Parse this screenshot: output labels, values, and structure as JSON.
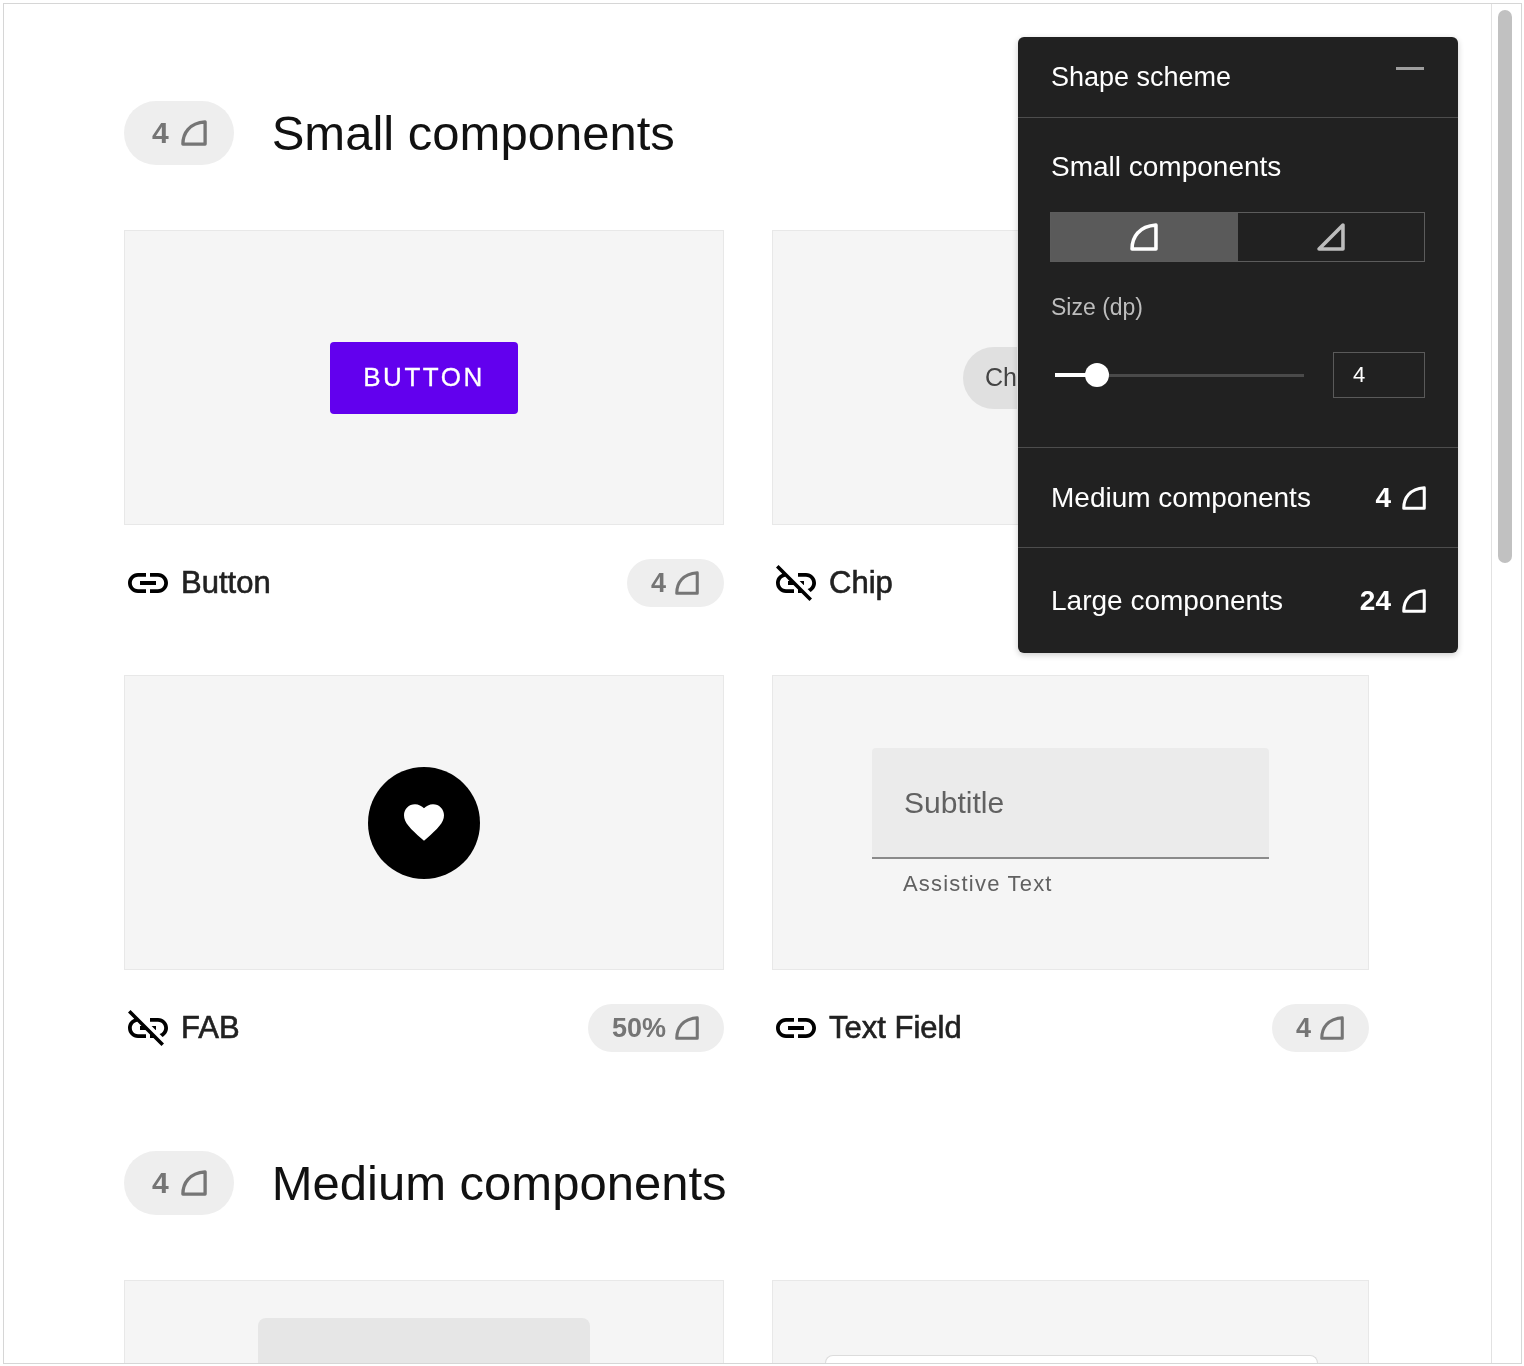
{
  "sections": [
    {
      "title": "Small components",
      "badge": "4",
      "rows": [
        [
          {
            "kind": "button",
            "name": "Button",
            "linked": true,
            "badge": "4",
            "preview_text": "BUTTON"
          },
          {
            "kind": "chip",
            "name": "Chip",
            "linked": false,
            "preview_text": "Ch"
          }
        ],
        [
          {
            "kind": "fab",
            "name": "FAB",
            "linked": false,
            "badge": "50%"
          },
          {
            "kind": "text_field",
            "name": "Text Field",
            "linked": true,
            "badge": "4",
            "placeholder": "Subtitle",
            "helper": "Assistive Text"
          }
        ]
      ]
    },
    {
      "title": "Medium components",
      "badge": "4",
      "rows": [
        [
          {
            "kind": "tile"
          },
          {
            "kind": "outlined"
          }
        ]
      ]
    }
  ],
  "panel": {
    "title": "Shape scheme",
    "sections": [
      {
        "title": "Small components",
        "expanded": true,
        "corner_options": [
          {
            "kind": "rounded",
            "selected": true
          },
          {
            "kind": "cut",
            "selected": false
          }
        ],
        "size_label": "Size (dp)",
        "level": 0.17,
        "value": "4"
      },
      {
        "title": "Medium components",
        "expanded": false,
        "value": "4"
      },
      {
        "title": "Large components",
        "expanded": false,
        "value": "24"
      }
    ]
  }
}
